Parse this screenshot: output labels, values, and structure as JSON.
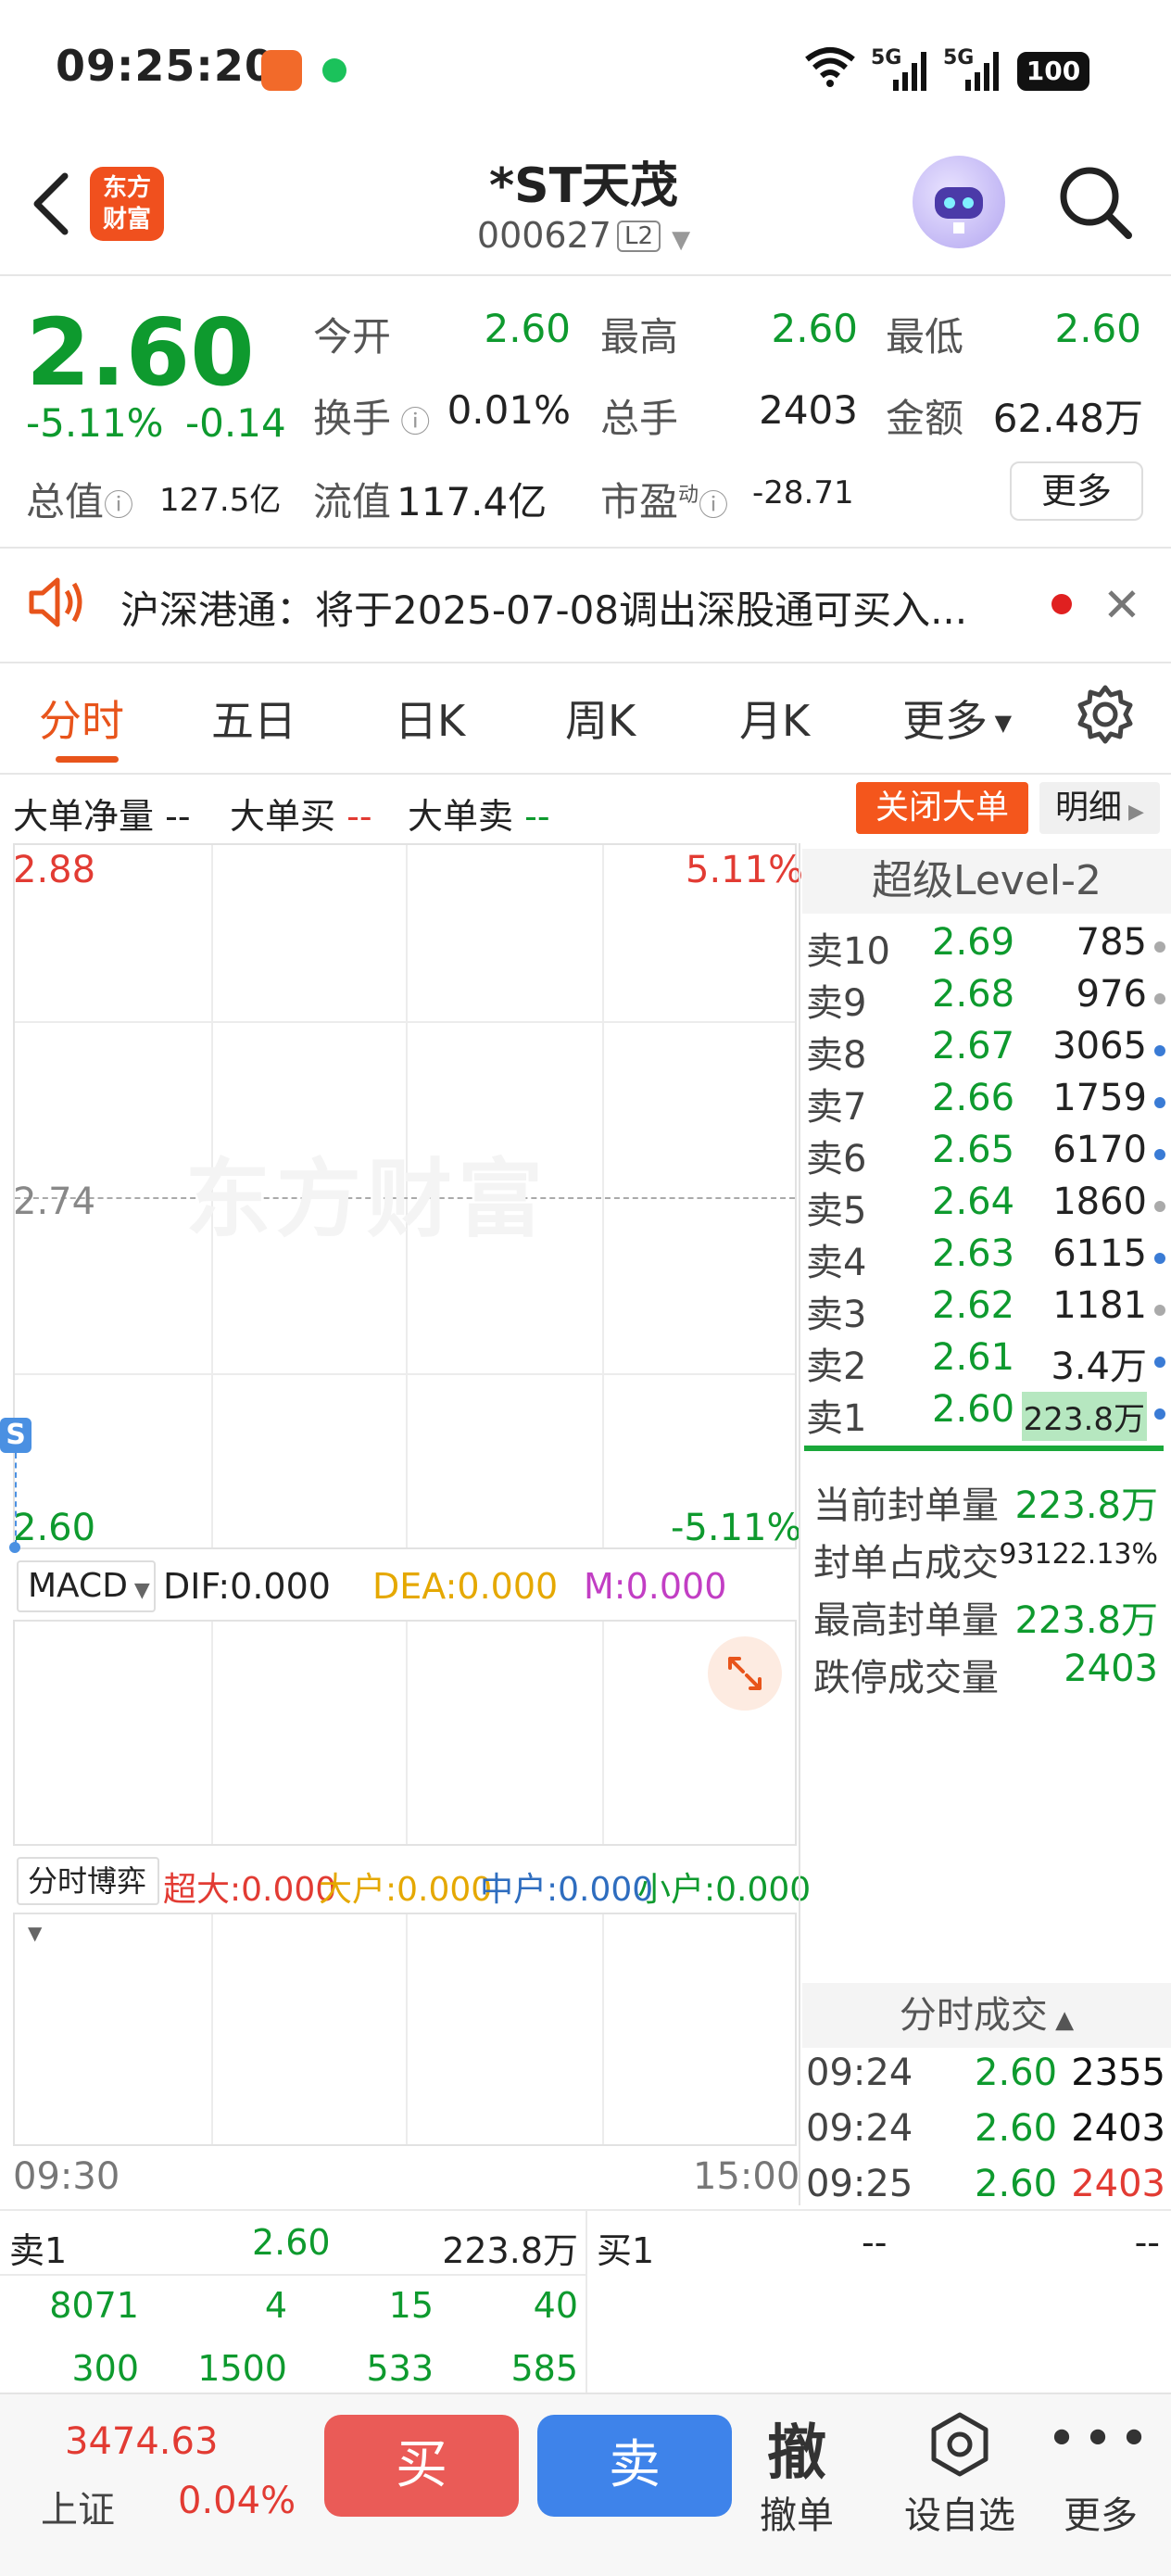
{
  "status_bar": {
    "time": "09:25:20",
    "signal1": "5G",
    "signal2": "5G",
    "battery": "100"
  },
  "header": {
    "logo_line1": "东方",
    "logo_line2": "财富",
    "title": "*ST天茂",
    "code": "000627",
    "level_badge": "L2"
  },
  "quote": {
    "price": "2.60",
    "change_pct": "-5.11%",
    "change": "-0.14",
    "open_label": "今开",
    "open": "2.60",
    "high_label": "最高",
    "high": "2.60",
    "low_label": "最低",
    "low": "2.60",
    "turnover_label": "换手",
    "turnover": "0.01%",
    "volume_label": "总手",
    "volume": "2403",
    "amount_label": "金额",
    "amount": "62.48万",
    "mktcap_label": "总值",
    "mktcap": "127.5亿",
    "float_label": "流值",
    "float_cap": "117.4亿",
    "pe_label": "市盈",
    "pe_sup": "动",
    "pe": "-28.71",
    "more_label": "更多"
  },
  "notice": {
    "text": "沪深港通：将于2025-07-08调出深股通可买入..."
  },
  "tabs": [
    "分时",
    "五日",
    "日K",
    "周K",
    "月K",
    "更多"
  ],
  "large_orders": {
    "net_label": "大单净量",
    "net": "--",
    "buy_label": "大单买",
    "buy": "--",
    "sell_label": "大单卖",
    "sell": "--",
    "close_btn": "关闭大单",
    "detail_btn": "明细"
  },
  "chart": {
    "top_price": "2.88",
    "top_pct": "5.11%",
    "mid_price": "2.74",
    "bottom_price": "2.60",
    "bottom_pct": "-5.11%",
    "watermark": "东方财富",
    "marker": "S",
    "time_start": "09:30",
    "time_end": "15:00"
  },
  "macd": {
    "select": "MACD",
    "dif": "DIF:0.000",
    "dea": "DEA:0.000",
    "m": "M:0.000"
  },
  "fenshi_boyi": {
    "select": "分时博弈",
    "chaoda": "超大:0.000",
    "dahu": "大户:0.000",
    "zhonghu": "中户:0.000",
    "xiaohu": "小户:0.000"
  },
  "level2": {
    "title": "超级Level-2",
    "asks": [
      {
        "label": "卖10",
        "price": "2.69",
        "vol": "785",
        "dot": "#aaaaaa"
      },
      {
        "label": "卖9",
        "price": "2.68",
        "vol": "976",
        "dot": "#aaaaaa"
      },
      {
        "label": "卖8",
        "price": "2.67",
        "vol": "3065",
        "dot": "#3a7bd5"
      },
      {
        "label": "卖7",
        "price": "2.66",
        "vol": "1759",
        "dot": "#3a7bd5"
      },
      {
        "label": "卖6",
        "price": "2.65",
        "vol": "6170",
        "dot": "#3a7bd5"
      },
      {
        "label": "卖5",
        "price": "2.64",
        "vol": "1860",
        "dot": "#aaaaaa"
      },
      {
        "label": "卖4",
        "price": "2.63",
        "vol": "6115",
        "dot": "#3a7bd5"
      },
      {
        "label": "卖3",
        "price": "2.62",
        "vol": "1181",
        "dot": "#aaaaaa"
      },
      {
        "label": "卖2",
        "price": "2.61",
        "vol": "3.4万",
        "dot": "#3a7bd5"
      },
      {
        "label": "卖1",
        "price": "2.60",
        "vol": "223.8万",
        "dot": "#3a7bd5"
      }
    ],
    "seal": [
      {
        "label": "当前封单量",
        "value": "223.8万"
      },
      {
        "label": "封单占成交",
        "value": "93122.13%"
      },
      {
        "label": "最高封单量",
        "value": "223.8万"
      },
      {
        "label": "跌停成交量",
        "value": "2403"
      }
    ],
    "trades_title": "分时成交",
    "trades": [
      {
        "time": "09:24",
        "price": "2.60",
        "vol": "2355",
        "color": "#111111"
      },
      {
        "time": "09:24",
        "price": "2.60",
        "vol": "2403",
        "color": "#111111"
      },
      {
        "time": "09:25",
        "price": "2.60",
        "vol": "2403",
        "color": "#e23b33"
      }
    ]
  },
  "book": {
    "sell1_label": "卖1",
    "sell1_price": "2.60",
    "sell1_vol": "223.8万",
    "buy1_label": "买1",
    "buy1_price": "--",
    "buy1_vol": "--",
    "row1": [
      "8071",
      "4",
      "15",
      "40"
    ],
    "row2": [
      "300",
      "1500",
      "533",
      "585"
    ]
  },
  "footer": {
    "index_value": "3474.63",
    "index_name": "上证",
    "index_pct": "0.04%",
    "buy": "买",
    "sell": "卖",
    "cancel_icon": "撤",
    "cancel": "撤单",
    "watch": "设自选",
    "more": "更多"
  }
}
